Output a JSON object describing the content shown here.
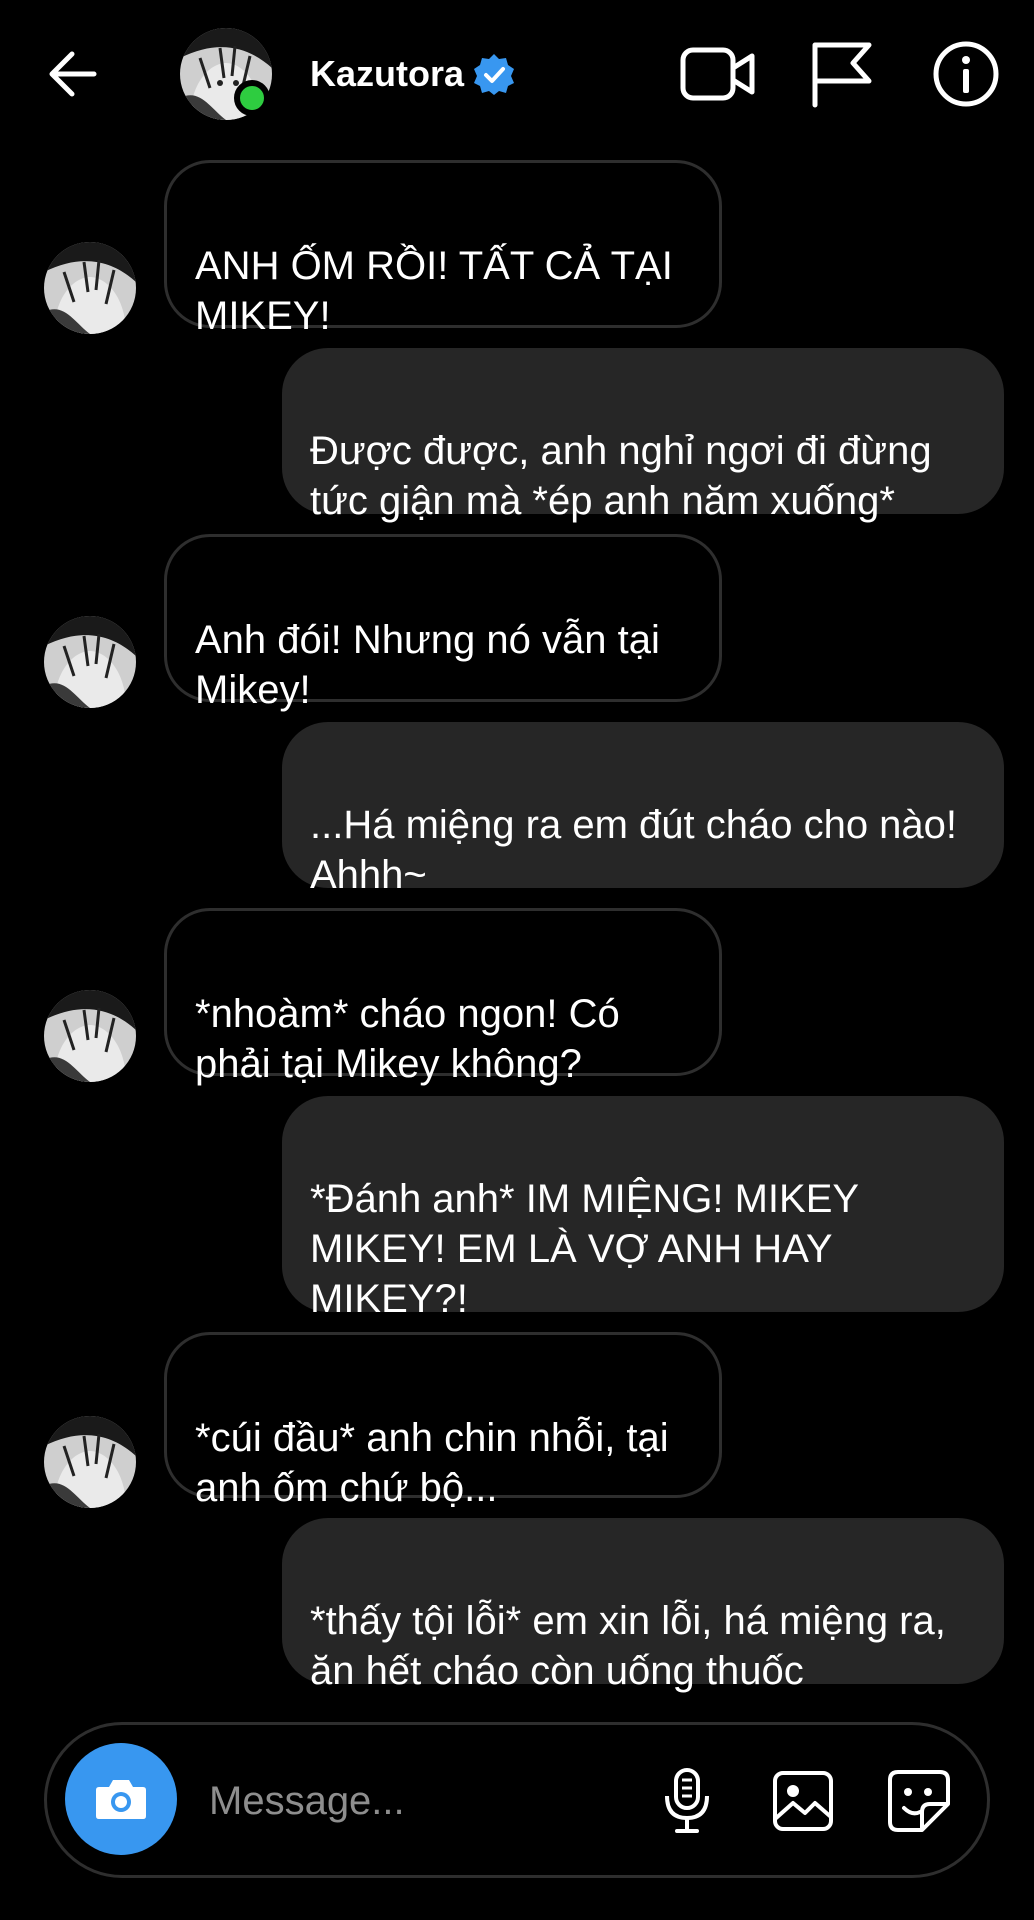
{
  "app": {
    "accent_color": "#3897f0",
    "online_color": "#2ecc40",
    "bubble_out_color": "#262626",
    "bubble_in_border_color": "#2e2e2e"
  },
  "header": {
    "contact_name": "Kazutora",
    "verified": true,
    "online": true,
    "icons": [
      "back-arrow-icon",
      "video-call-icon",
      "flag-icon",
      "info-icon"
    ]
  },
  "messages": [
    {
      "direction": "in",
      "text": "ANH ỐM RỒI! TẤT CẢ TẠI MIKEY!"
    },
    {
      "direction": "out",
      "text": "Được được, anh nghỉ ngơi đi đừng tức giận mà *ép anh năm xuống*"
    },
    {
      "direction": "in",
      "text": "Anh đói! Nhưng nó vẫn tại Mikey!"
    },
    {
      "direction": "out",
      "text": "...Há miệng ra em đút cháo cho nào! Ahhh~"
    },
    {
      "direction": "in",
      "text": "*nhoàm* cháo ngon! Có phải tại Mikey không?"
    },
    {
      "direction": "out",
      "text": "*Đánh anh* IM MIỆNG! MIKEY MIKEY! EM LÀ VỢ ANH HAY MIKEY?!"
    },
    {
      "direction": "in",
      "text": "*cúi đầu* anh chin nhỗi, tại anh ốm chứ bộ..."
    },
    {
      "direction": "out",
      "text": "*thấy tội lỗi* em xin lỗi, há miệng ra, ăn hết cháo còn uống thuốc"
    }
  ],
  "composer": {
    "placeholder": "Message...",
    "icons": [
      "camera-icon",
      "microphone-icon",
      "gallery-icon",
      "sticker-icon"
    ]
  }
}
